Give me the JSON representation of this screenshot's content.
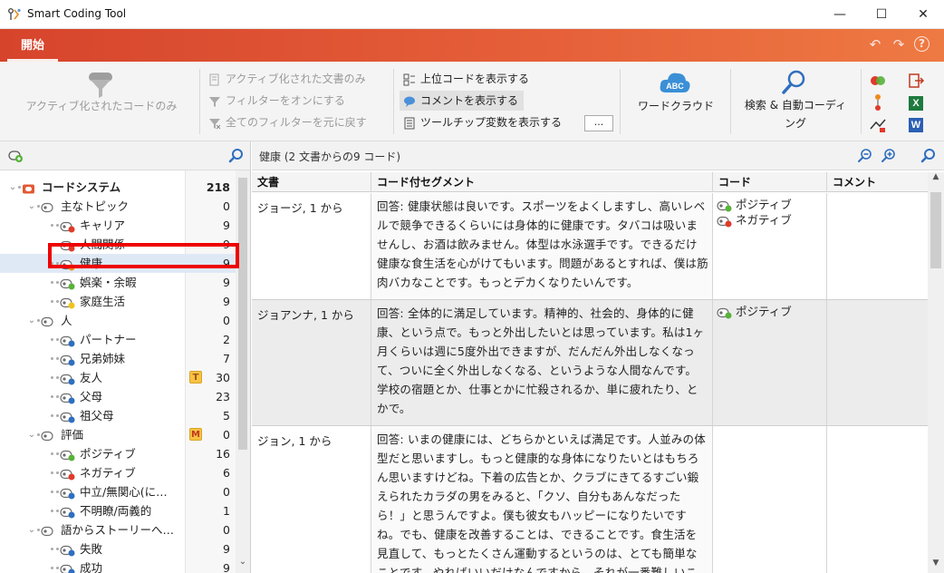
{
  "window": {
    "title": "Smart Coding Tool",
    "minimize": "—",
    "maximize": "☐",
    "close": "✕"
  },
  "ribbon": {
    "tab_start": "開始",
    "activated_codes_only": "アクティブ化されたコードのみ",
    "activated_docs_only": "アクティブ化された文書のみ",
    "filter_on": "フィルターをオンにする",
    "reset_filters": "全てのフィルターを元に戻す",
    "show_top_codes": "上位コードを表示する",
    "show_comments": "コメントを表示する",
    "show_tooltip_vars": "ツールチップ変数を表示する",
    "more_btn": "...",
    "wordcloud": "ワードクラウド",
    "wordcloud_icon_text": "ABC",
    "search_autocode_1": "検索 & 自動コーディ",
    "search_autocode_2": "ング",
    "excel_label": "X",
    "word_label": "W"
  },
  "tree": {
    "rows": [
      {
        "label": "コードシステム",
        "count": "218"
      },
      {
        "label": "主なトピック",
        "count": "0"
      },
      {
        "label": "キャリア",
        "count": "9"
      },
      {
        "label": "人間関係",
        "count": "9"
      },
      {
        "label": "健康",
        "count": "9"
      },
      {
        "label": "娯楽・余暇",
        "count": "9"
      },
      {
        "label": "家庭生活",
        "count": "9"
      },
      {
        "label": "人",
        "count": "0"
      },
      {
        "label": "パートナー",
        "count": "2"
      },
      {
        "label": "兄弟姉妹",
        "count": "7"
      },
      {
        "label": "友人",
        "count": "30",
        "badge": "T"
      },
      {
        "label": "父母",
        "count": "23"
      },
      {
        "label": "祖父母",
        "count": "5"
      },
      {
        "label": "評価",
        "count": "0",
        "badge": "M"
      },
      {
        "label": "ポジティブ",
        "count": "16"
      },
      {
        "label": "ネガティブ",
        "count": "6"
      },
      {
        "label": "中立/無関心(に…",
        "count": "0"
      },
      {
        "label": "不明瞭/両義的",
        "count": "1"
      },
      {
        "label": "語からストーリーへ…",
        "count": "0"
      },
      {
        "label": "失敗",
        "count": "9"
      },
      {
        "label": "成功",
        "count": "9"
      }
    ]
  },
  "right": {
    "title": "健康 (2 文書からの9 コード)",
    "columns": {
      "doc": "文書",
      "segment": "コード付セグメント",
      "code": "コード",
      "comment": "コメント"
    },
    "rows": [
      {
        "doc": "ジョージ, 1 から",
        "segment": "回答: 健康状態は良いです。スポーツをよくしますし、高いレベルで競争できるくらいには身体的に健康です。タバコは吸いませんし、お酒は飲みません。体型は水泳選手です。できるだけ健康な食生活を心がけてもいます。問題があるとすれば、僕は筋肉バカなことです。もっとデカくなりたいんです。",
        "codes": [
          "ポジティブ",
          "ネガティブ"
        ]
      },
      {
        "doc": "ジョアンナ, 1 から",
        "segment": "回答: 全体的に満足しています。精神的、社会的、身体的に健康、という点で。もっと外出したいとは思っています。私は1ヶ月くらいは週に5度外出できますが、だんだん外出しなくなって、ついに全く外出しなくなる、というような人間なんです。 学校の宿題とか、仕事とかに忙殺されるか、単に疲れたり、とかで。",
        "codes": [
          "ポジティブ"
        ]
      },
      {
        "doc": "ジョン, 1 から",
        "segment": "回答: いまの健康には、どちらかといえば満足です。人並みの体型だと思いますし。もっと健康的な身体になりたいとはもちろん思いますけどね。下着の広告とか、クラブにきてるすごい鍛えられたカラダの男をみると、「クソ、自分もあんなだったら！」と思うんですよ。僕も彼女もハッピーになりたいですね。でも、健康を改善することは、できることです。食生活を見直して、もっとたくさん運動するというのは、とても簡単なことです。やればいいだけなんですから。それが一番難しいこと",
        "codes": []
      }
    ]
  },
  "colors": {
    "ribbon_orange": "#e05a35",
    "code_blue": "#2f6fbf",
    "code_green": "#58b23a",
    "code_red": "#e03a2a",
    "code_orange": "#f08a1c",
    "code_yellow": "#f0c419",
    "highlight_red": "#ee0000"
  }
}
